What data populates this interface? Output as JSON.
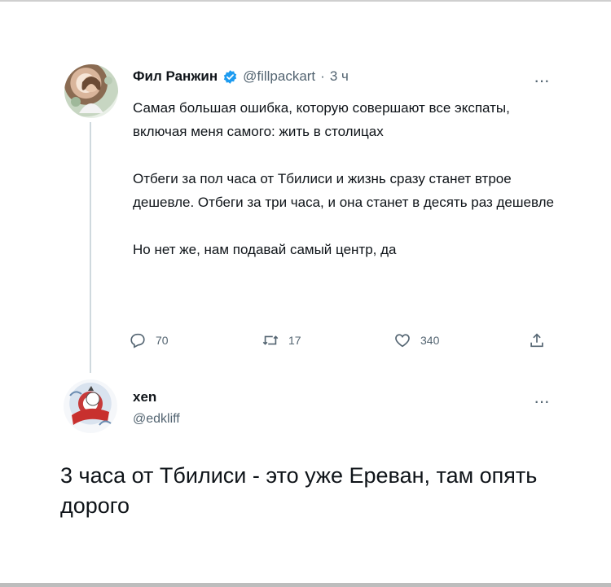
{
  "tweet": {
    "author_name": "Фил Ранжин",
    "handle": "@fillpackart",
    "separator": "·",
    "time": "3 ч",
    "more": "···",
    "paragraphs": [
      "Самая большая ошибка, которую совершают все экспаты, включая меня самого: жить в столицах",
      "Отбеги за пол часа от Тбилиси и жизнь сразу станет втрое дешевле. Отбеги за три часа, и она станет в десять раз дешевле",
      "Но нет же, нам подавай самый центр, да"
    ],
    "stats": {
      "replies": "70",
      "retweets": "17",
      "likes": "340"
    }
  },
  "reply": {
    "author_name": "xen",
    "handle": "@edkliff",
    "more": "···",
    "text": "3 часа от Тбилиси - это уже Ереван, там опять дорого"
  },
  "colors": {
    "text": "#0f1419",
    "secondary": "#536471",
    "verified": "#1d9bf0",
    "thread_line": "#cfd9de"
  },
  "icons": [
    "verified-badge-icon",
    "reply-icon",
    "retweet-icon",
    "like-icon",
    "share-icon",
    "more-icon"
  ]
}
